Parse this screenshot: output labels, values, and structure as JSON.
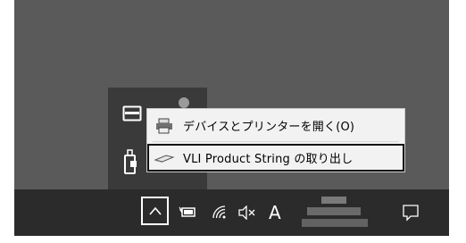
{
  "context_menu": {
    "items": [
      {
        "label": "デバイスとプリンターを開く(O)",
        "icon": "printer-icon"
      },
      {
        "label": "VLI Product String の取り出し",
        "icon": "usb-drive-icon"
      }
    ]
  },
  "taskbar": {
    "ime_indicator": "A",
    "icons": [
      "chevron-up-icon",
      "battery-icon",
      "wifi-icon",
      "volume-muted-icon",
      "notification-icon"
    ]
  },
  "colors": {
    "taskbar": "#2b2b2b",
    "desktop": "#5a5a5a",
    "menu": "#f2f2f2",
    "highlight_border": "#111111"
  }
}
